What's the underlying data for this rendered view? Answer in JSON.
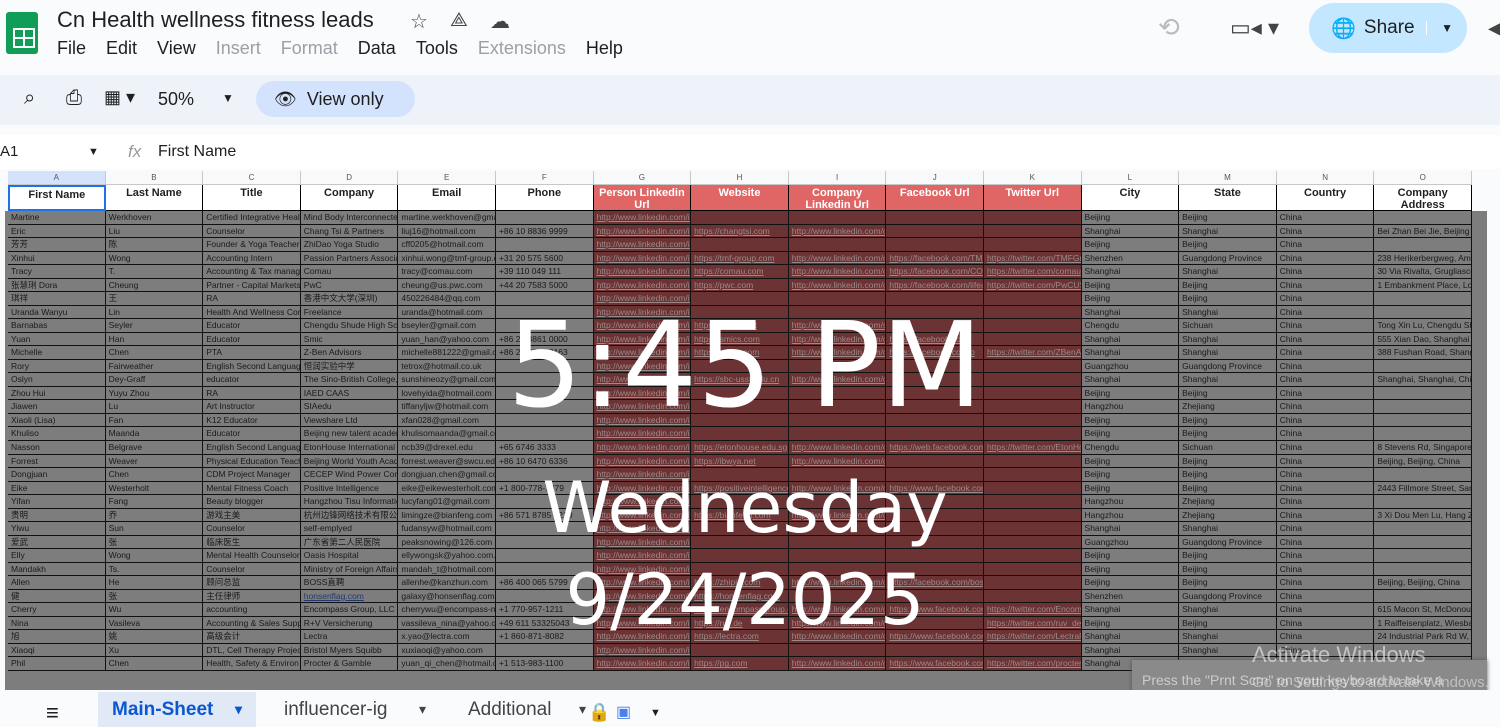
{
  "app": {
    "title": "Cn Health wellness fitness leads",
    "share_label": "Share",
    "accent": "#c2e7ff"
  },
  "menu": [
    "File",
    "Edit",
    "View",
    "Insert",
    "Format",
    "Data",
    "Tools",
    "Extensions",
    "Help"
  ],
  "menu_disabled": [
    false,
    false,
    false,
    true,
    true,
    false,
    false,
    true,
    false
  ],
  "toolbar": {
    "zoom": "50%",
    "view_only": "View only"
  },
  "formula": {
    "cell_ref": "A1",
    "fx": "fx",
    "value": "First Name"
  },
  "columns": [
    "A",
    "B",
    "C",
    "D",
    "E",
    "F",
    "G",
    "H",
    "I",
    "J",
    "K",
    "L",
    "M",
    "N",
    "O"
  ],
  "headers": [
    "First Name",
    "Last Name",
    "Title",
    "Company",
    "Email",
    "Phone",
    "Person Linkedin Url",
    "Website",
    "Company Linkedin Url",
    "Facebook Url",
    "Twitter Url",
    "City",
    "State",
    "Country",
    "Company Address"
  ],
  "header_red": [
    false,
    false,
    false,
    false,
    false,
    false,
    true,
    true,
    true,
    true,
    true,
    false,
    false,
    false,
    false
  ],
  "rows": [
    [
      "Martine",
      "Werkhoven",
      "Certified Integrative Heal",
      "Mind Body Interconnecte",
      "martine.werkhoven@gmail.com",
      "",
      "http://www.linkedin.com/in",
      "",
      "",
      "",
      "",
      "Beijing",
      "Beijing",
      "China",
      ""
    ],
    [
      "Eric",
      "Liu",
      "Counselor",
      "Chang Tsi & Partners",
      "liuj16@hotmail.com",
      "+86 10 8836 9999",
      "http://www.linkedin.com/in",
      "https://changtsi.com",
      "http://www.linkedin.com/c",
      "",
      "",
      "Shanghai",
      "Shanghai",
      "China",
      "Bei Zhan Bei Jie, Beijing"
    ],
    [
      "芳芳",
      "陈",
      "Founder & Yoga Teacher",
      "ZhiDao Yoga Studio",
      "cff0205@hotmail.com",
      "",
      "http://www.linkedin.com/in",
      "",
      "",
      "",
      "",
      "Beijing",
      "Beijing",
      "China",
      ""
    ],
    [
      "Xinhui",
      "Wong",
      "Accounting Intern",
      "Passion Partners Associa",
      "xinhui.wong@tmf-group.c",
      "+31 20 575 5600",
      "http://www.linkedin.com/in",
      "https://tmf-group.com",
      "http://www.linkedin.com/c",
      "https://facebook.com/TMI",
      "https://twitter.com/TMFGr",
      "Shenzhen",
      "Guangdong Province",
      "China",
      "238 Herikerbergweg, Ams"
    ],
    [
      "Tracy",
      "T.",
      "Accounting & Tax manag",
      "Comau",
      "tracy@comau.com",
      "+39 110 049 111",
      "http://www.linkedin.com/in",
      "https://comau.com",
      "http://www.linkedin.com/c",
      "https://facebook.com/CO",
      "https://twitter.com/comau",
      "Shanghai",
      "Shanghai",
      "China",
      "30 Via Rivalta, Grugliasco"
    ],
    [
      "张慧琍 Dora",
      "Cheung",
      "Partner - Capital Markets",
      "PwC",
      "cheung@us.pwc.com",
      "+44 20 7583 5000",
      "http://www.linkedin.com/in",
      "https://pwc.com",
      "http://www.linkedin.com/c",
      "https://facebook.com/lifea",
      "https://twitter.com/PwCUS",
      "Beijing",
      "Beijing",
      "China",
      "1 Embankment Place, Lo"
    ],
    [
      "琪祥",
      "王",
      "RA",
      "香港中文大学(深圳)",
      "450226484@qq.com",
      "",
      "http://www.linkedin.com/in",
      "",
      "",
      "",
      "",
      "Beijing",
      "Beijing",
      "China",
      ""
    ],
    [
      "Uranda Wanyu",
      "Lin",
      "Health And Wellness Con",
      "Freelance",
      "uranda@hotmail.com",
      "",
      "http://www.linkedin.com/in",
      "",
      "",
      "",
      "",
      "Shanghai",
      "Shanghai",
      "China",
      ""
    ],
    [
      "Barnabas",
      "Seyler",
      "Educator",
      "Chengdu Shude High Sc",
      "bseyler@gmail.com",
      "",
      "http://www.linkedin.com/in",
      "https://shude.net",
      "http://www.linkedin.com/s",
      "",
      "",
      "Chengdu",
      "Sichuan",
      "China",
      "Tong Xin Lu, Chengdu Sh"
    ],
    [
      "Yuan",
      "Han",
      "Educator",
      "Smic",
      "yuan_han@yahoo.com",
      "+86 21 3861 0000",
      "http://www.linkedin.com/in",
      "https://smics.com",
      "http://www.linkedin.com/c",
      "https://facebook.com",
      "",
      "Shanghai",
      "Shanghai",
      "China",
      "555 Xian Dao, Shanghai"
    ],
    [
      "Michelle",
      "Chen",
      "PTA",
      "Z-Ben Advisors",
      "michelle881222@gmail.c",
      "+86 21 6075 8163",
      "http://www.linkedin.com/in",
      "https://z-ben.com",
      "http://www.linkedin.com/c",
      "https://facebook.com/p",
      "https://twitter.com/ZBenA",
      "Shanghai",
      "Shanghai",
      "China",
      "388 Fushan Road, Shang"
    ],
    [
      "Rory",
      "Fairweather",
      "English Second Languag",
      "恒润实验中学",
      "tetrox@hotmail.co.uk",
      "",
      "http://www.linkedin.com/in",
      "",
      "",
      "",
      "",
      "Guangzhou",
      "Guangdong Province",
      "China",
      ""
    ],
    [
      "Oslyn",
      "Dey-Graff",
      "educator",
      "The Sino-British College,",
      "sunshineozy@gmail.com",
      "",
      "http://www.linkedin.com/in",
      "https://sbc-usst.edu.cn",
      "http://www.linkedin.com/c",
      "",
      "",
      "Shanghai",
      "Shanghai",
      "China",
      "Shanghai, Shanghai, Chi"
    ],
    [
      "Zhou Hui",
      "Yuyu Zhou",
      "RA",
      "IAED CAAS",
      "lovehyida@hotmail.com",
      "",
      "http://www.linkedin.com/in",
      "",
      "",
      "",
      "",
      "Beijing",
      "Beijing",
      "China",
      ""
    ],
    [
      "Jiawen",
      "Lu",
      "Art Instructor",
      "SIAedu",
      "tiffanyljw@hotmail.com",
      "",
      "http://www.linkedin.com/in",
      "",
      "",
      "",
      "",
      "Hangzhou",
      "Zhejiang",
      "China",
      ""
    ],
    [
      "Xiaoli (Lisa)",
      "Fan",
      "K12 Educator",
      "Viewshare Ltd",
      "xfan028@gmail.com",
      "",
      "http://www.linkedin.com/in",
      "",
      "",
      "",
      "",
      "Beijing",
      "Beijing",
      "China",
      ""
    ],
    [
      "Khuliso",
      "Maanda",
      "Educator",
      "Beijing new talent acader",
      "khulisomaanda@gmail.com",
      "",
      "http://www.linkedin.com/in",
      "",
      "",
      "",
      "",
      "Beijing",
      "Beijing",
      "China",
      ""
    ],
    [
      "Nasson",
      "Belgrave",
      "English Second Languag",
      "EtonHouse International",
      "ncb39@drexel.edu",
      "+65 6746 3333",
      "http://www.linkedin.com/in",
      "https://etonhouse.edu.sg",
      "http://www.linkedin.com/c",
      "https://web.facebook.com",
      "https://twitter.com/EtonHo",
      "Chengdu",
      "Sichuan",
      "China",
      "8 Stevens Rd, Singapore"
    ],
    [
      "Forrest",
      "Weaver",
      "Physical Education Teach",
      "Beijing World Youth Acad",
      "forrest.weaver@swcu.edu",
      "+86 10 6470 6336",
      "http://www.linkedin.com/in",
      "https://ibwya.net",
      "http://www.linkedin.com/c",
      "",
      "",
      "Beijing",
      "Beijing",
      "China",
      "Beijing, Beijing, China"
    ],
    [
      "Dongjuan",
      "Chen",
      "CDM Project Manager",
      "CECEP Wind Power Con",
      "dongjuan.chen@gmail.com",
      "",
      "http://www.linkedin.com/in",
      "",
      "",
      "",
      "",
      "Beijing",
      "Beijing",
      "China",
      ""
    ],
    [
      "Eike",
      "Westerholt",
      "Mental Fitness Coach",
      "Positive Intelligence",
      "eike@eikewesterholt.com",
      "+1 800-778-7879",
      "http://www.linkedin.com/in",
      "https://positiveintelligence",
      "http://www.linkedin.com/c",
      "https://www.facebook.com",
      "",
      "Beijing",
      "Beijing",
      "China",
      "2443 Fillmore Street, Sar"
    ],
    [
      "Yifan",
      "Fang",
      "Beauty blogger",
      "Hangzhou Tisu Informatic",
      "lucyfang01@gmail.com",
      "",
      "http://www.linkedin.com/in",
      "",
      "",
      "",
      "",
      "Hangzhou",
      "Zhejiang",
      "China",
      ""
    ],
    [
      "贵明",
      "乔",
      "游戏主美",
      "杭州边锋网络技术有限公司",
      "limingze@bianfeng.com",
      "+86 571 8785 9210",
      "http://www.linkedin.com/in",
      "https://bianfeng.com",
      "http://www.linkedin.com/c",
      "",
      "",
      "Hangzhou",
      "Zhejiang",
      "China",
      "3 Xi Dou Men Lu, Hang Z"
    ],
    [
      "Yiwu",
      "Sun",
      "Counselor",
      "self-emplyed",
      "fudansyw@hotmail.com",
      "",
      "http://www.linkedin.com/in",
      "",
      "",
      "",
      "",
      "Shanghai",
      "Shanghai",
      "China",
      ""
    ],
    [
      "爱武",
      "张",
      "临床医生",
      "广东省第二人民医院",
      "peaksnowing@126.com",
      "",
      "http://www.linkedin.com/in",
      "",
      "",
      "",
      "",
      "Guangzhou",
      "Guangdong Province",
      "China",
      ""
    ],
    [
      "Elly",
      "Wong",
      "Mental Health Counselor",
      "Oasis Hospital",
      "ellywongsk@yahoo.com.au",
      "",
      "http://www.linkedin.com/in",
      "",
      "",
      "",
      "",
      "Beijing",
      "Beijing",
      "China",
      ""
    ],
    [
      "Mandakh",
      "Ts.",
      "Counselor",
      "Ministry of Foreign Affairs",
      "mandah_t@hotmail.com",
      "",
      "http://www.linkedin.com/in",
      "",
      "",
      "",
      "",
      "Beijing",
      "Beijing",
      "China",
      ""
    ],
    [
      "Allen",
      "He",
      "顾问总监",
      "BOSS直聘",
      "allenhe@kanzhun.com",
      "+86 400 065 5799",
      "http://www.linkedin.com/in",
      "https://zhipin.com",
      "http://www.linkedin.com/c",
      "https://facebook.com/bos",
      "",
      "Beijing",
      "Beijing",
      "China",
      "Beijing, Beijing, China"
    ],
    [
      "健",
      "张",
      "主任律师",
      "honsenflag.com",
      "galaxy@honsenflag.com",
      "",
      "http://www.linkedin.com/in",
      "https://honsenflag.com",
      "",
      "",
      "",
      "Shenzhen",
      "Guangdong Province",
      "China",
      ""
    ],
    [
      "Cherry",
      "Wu",
      "accounting",
      "Encompass Group, LLC",
      "cherrywu@encompass-m",
      "+1 770-957-1211",
      "http://www.linkedin.com/in",
      "https://encompassgroup.c",
      "http://www.linkedin.com/c",
      "https://www.facebook.com",
      "https://twitter.com/Encom",
      "Shanghai",
      "Shanghai",
      "China",
      "615 Macon St, McDonou"
    ],
    [
      "Nina",
      "Vasileva",
      "Accounting & Sales Supp",
      "R+V Versicherung",
      "vassileva_nina@yahoo.c",
      "+49 611 53325043",
      "http://www.linkedin.com/in",
      "https://ruv.de",
      "http://www.linkedin.com/c",
      "",
      "https://twitter.com/ruv_de",
      "Beijing",
      "Beijing",
      "China",
      "1 Raiffeisenplatz, Wiesba"
    ],
    [
      "旭",
      "姚",
      "高级会计",
      "Lectra",
      "x.yao@lectra.com",
      "+1 860-871-8082",
      "http://www.linkedin.com/in",
      "https://lectra.com",
      "http://www.linkedin.com/c",
      "https://www.facebook.com",
      "https://twitter.com/LectraF",
      "Shanghai",
      "Shanghai",
      "China",
      "24 Industrial Park Rd W,"
    ],
    [
      "Xiaoqi",
      "Xu",
      "DTL, Cell Therapy Projec",
      "Bristol Myers Squibb",
      "xuxiaoqi@yahoo.com",
      "",
      "http://www.linkedin.com/in",
      "",
      "",
      "",
      "",
      "Shanghai",
      "Shanghai",
      "China",
      ""
    ],
    [
      "Phil",
      "Chen",
      "Health, Safety & Environ",
      "Procter & Gamble",
      "yuan_qi_chen@hotmail.c",
      "+1 513-983-1100",
      "http://www.linkedin.com/in",
      "https://pg.com",
      "http://www.linkedin.com/c",
      "https://www.facebook.com",
      "https://twitter.com/procter",
      "Shanghai",
      "Shanghai",
      "China",
      "2 Procter & Gamble Plaz"
    ]
  ],
  "lock_screen": {
    "time": "5:45 PM",
    "day": "Wednesday",
    "date": "9/24/2025"
  },
  "sheet_tabs": [
    {
      "label": "Main-Sheet",
      "active": true
    },
    {
      "label": "influencer-ig",
      "active": false
    },
    {
      "label": "Additional",
      "active": false
    }
  ],
  "watermark": {
    "line1": "Activate Windows",
    "line2": "Go to Settings to activate Windows."
  },
  "toast": "Press the \"Prnt Scrn\" on your keyboard to take a screenshot",
  "colors": {
    "header_red": "#e06666",
    "link_col_dim": "#6c3335",
    "active_tab": "#0b57d0"
  }
}
